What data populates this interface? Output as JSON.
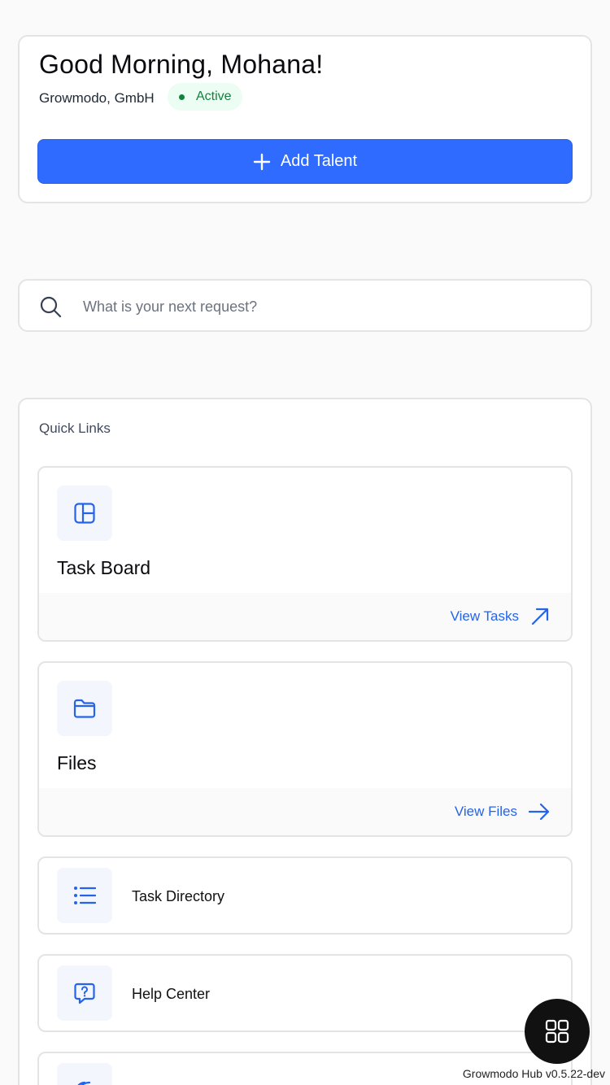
{
  "greeting": {
    "title": "Good Morning, Mohana!",
    "company": "Growmodo, GmbH",
    "status": "Active",
    "add_button_label": "Add Talent"
  },
  "search": {
    "placeholder": "What is your next request?"
  },
  "quick_links": {
    "title": "Quick Links",
    "task_board": {
      "title": "Task Board",
      "action": "View Tasks",
      "icon": "layout-board-icon"
    },
    "files": {
      "title": "Files",
      "action": "View Files",
      "icon": "folder-icon"
    },
    "task_directory": {
      "label": "Task Directory",
      "icon": "list-icon"
    },
    "help_center": {
      "label": "Help Center",
      "icon": "help-chat-icon"
    },
    "partial_item": {
      "icon": "signal-icon"
    }
  },
  "footer": {
    "version": "Growmodo Hub v0.5.22-dev",
    "fab_icon": "grid-icon"
  },
  "colors": {
    "primary": "#2f6bff",
    "link": "#2563eb",
    "status_green": "#15803d",
    "status_bg": "#ecfdf3",
    "fab": "#111111"
  }
}
